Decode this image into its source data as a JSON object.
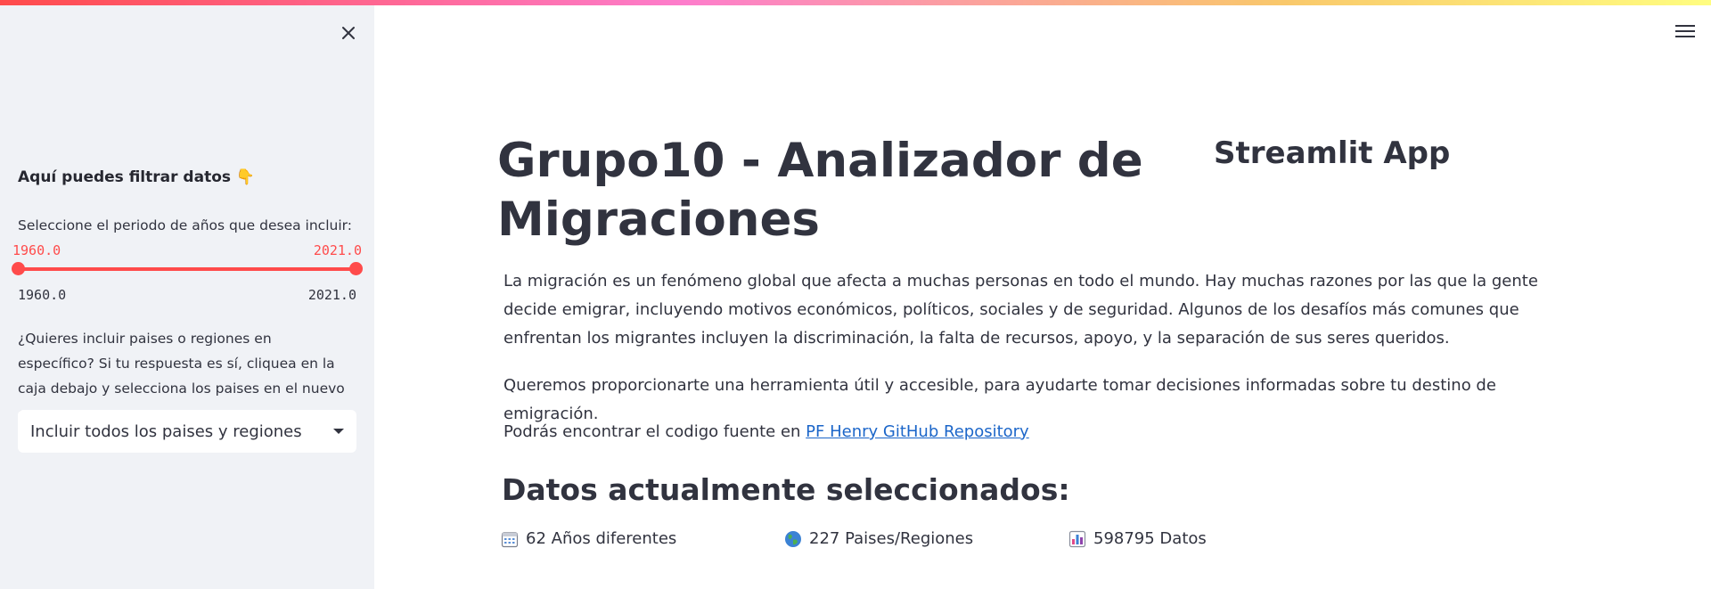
{
  "sidebar": {
    "filter_title": "Aquí puedes filtrar datos 👇",
    "slider": {
      "label": "Seleccione el periodo de años que desea incluir:",
      "value_low": "1960.0",
      "value_high": "2021.0",
      "min": "1960.0",
      "max": "2021.0"
    },
    "question": "¿Quieres incluir paises o regiones en específico? Si tu respuesta es sí, cliquea en la caja debajo y selecciona los paises en el nuevo campo.",
    "select_value": "Incluir todos los paises y regiones"
  },
  "header": {
    "main_title": "Grupo10 - Analizador de Migraciones",
    "app_title": "Streamlit App"
  },
  "main": {
    "paragraph1": "La migración es un fenómeno global que afecta a muchas personas en todo el mundo. Hay muchas razones por las que la gente decide emigrar, incluyendo motivos económicos, políticos, sociales y de seguridad. Algunos de los desafíos más comunes que enfrentan los migrantes incluyen la discriminación, la falta de recursos, apoyo, y la separación de sus seres queridos.",
    "paragraph2": "Queremos proporcionarte una herramienta útil y accesible, para ayudarte tomar decisiones informadas sobre tu destino de emigración.",
    "paragraph3_prefix": "Podrás encontrar el codigo fuente en ",
    "repo_link": "PF Henry GitHub Repository",
    "section_title": "Datos actualmente seleccionados:",
    "stats": [
      {
        "icon": "calendar-icon",
        "text": "62 Años diferentes"
      },
      {
        "icon": "globe-icon",
        "text": "227 Paises/Regiones"
      },
      {
        "icon": "bar-chart-icon",
        "text": "598795 Datos"
      }
    ]
  },
  "colors": {
    "accent": "#ff4b4b",
    "sidebar_bg": "#f0f2f6",
    "link": "#1c66c9",
    "text": "#31333f"
  }
}
